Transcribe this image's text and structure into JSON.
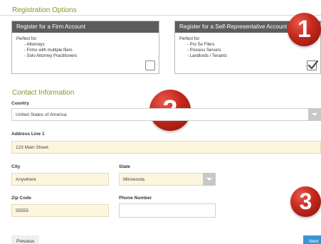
{
  "registration": {
    "title": "Registration Options",
    "firm_card": {
      "header": "Register for a Firm Account",
      "perfect_for": "Perfect for:",
      "items": [
        "- Attorneys",
        "- Firms with multiple filers",
        "- Solo Attorney Practitioners"
      ],
      "checked": false
    },
    "self_card": {
      "header": "Register for a Self-Representative Account",
      "perfect_for": "Perfect for:",
      "items": [
        "- Pro Se Filers",
        "- Process Servers",
        "- Landlords / Tenants"
      ],
      "checked": true
    }
  },
  "badges": [
    "1",
    "2",
    "3"
  ],
  "contact": {
    "title": "Contact Information",
    "country_label": "Country",
    "country_value": "United States of America",
    "address_label": "Address Line 1",
    "address_value": "123 Main Street",
    "city_label": "City",
    "city_value": "Anywhere",
    "state_label": "State",
    "state_value": "Minnesota",
    "zip_label": "Zip Code",
    "zip_value": "55555",
    "phone_label": "Phone Number",
    "phone_value": ""
  },
  "nav": {
    "previous_label": "Previous",
    "next_label": "Next"
  },
  "colors": {
    "accent_green": "#7a9a2c",
    "card_header": "#5d5d5d",
    "field_yellow": "#fdf6df",
    "next_blue": "#3c95d3",
    "badge_red": "#c2281c"
  }
}
